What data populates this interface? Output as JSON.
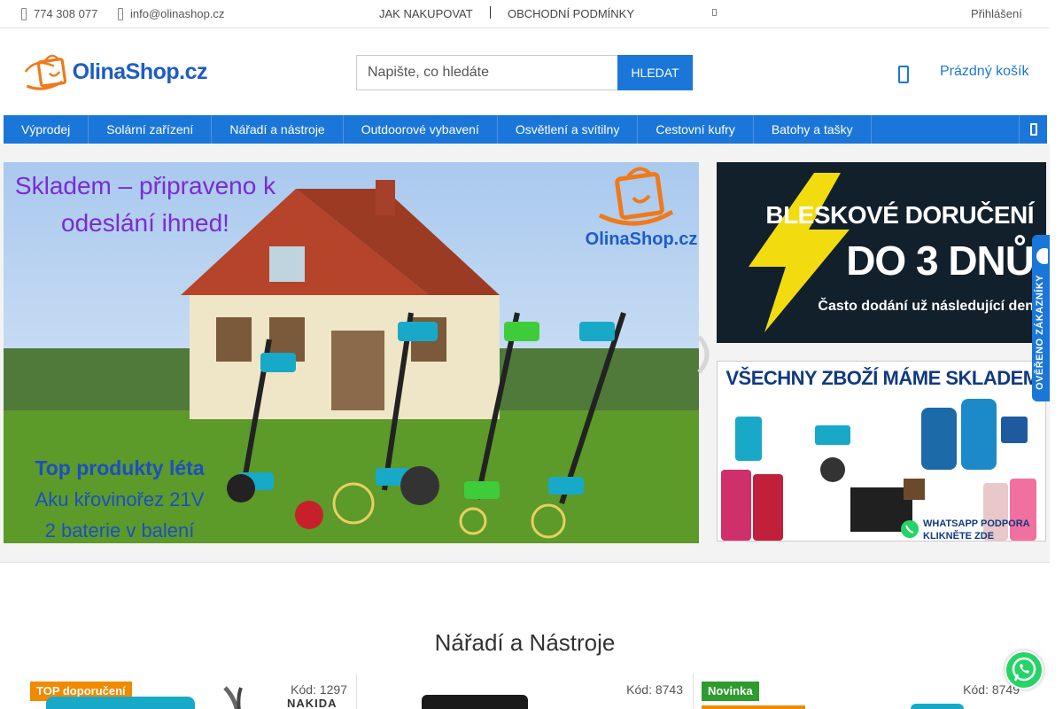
{
  "topbar": {
    "phone": "774 308 077",
    "email": "info@olinashop.cz",
    "links": [
      "JAK NAKUPOVAT",
      "OBCHODNÍ PODMÍNKY"
    ],
    "login": "Přihlášení"
  },
  "header": {
    "logo_text": "OlinaShop.cz",
    "search_placeholder": "Napište, co hledáte",
    "search_button": "HLEDAT",
    "cart_label": "Prázdný košík"
  },
  "nav": {
    "items": [
      "Výprodej",
      "Solární zařízení",
      "Nářadí a nástroje",
      "Outdoorové vybavení",
      "Osvětlení a svítilny",
      "Cestovní kufry",
      "Batohy a tašky"
    ]
  },
  "hero": {
    "headline_line1": "Skladem – připraveno k",
    "headline_line2": "odeslání ihned!",
    "logo_text": "OlinaShop.cz",
    "bottom_line1": "Top produkty léta",
    "bottom_line2": "Aku křovinořez 21V",
    "bottom_line3": "2 baterie v balení"
  },
  "side_banner_1": {
    "line1": "BLESKOVÉ DORUČENÍ",
    "line2": "DO 3 DNŮ",
    "line3": "Často dodání už následující den"
  },
  "side_banner_2": {
    "title": "VŠECHNY ZBOŽÍ MÁME SKLADEM",
    "whatsapp_line1": "WHATSAPP PODPORA",
    "whatsapp_line2": "KLIKNĚTE ZDE"
  },
  "verified_tab": "OVĚŘENO ZÁKAZNÍKY",
  "section": {
    "title": "Nářadí a Nástroje"
  },
  "products": [
    {
      "badge": "TOP doporučení",
      "code": "Kód: 1297",
      "brand": "NAKIDA"
    },
    {
      "badge": "",
      "code": "Kód: 8743"
    },
    {
      "badge": "Novinka",
      "code": "Kód: 8749"
    }
  ],
  "colors": {
    "brand_blue": "#1b76d9",
    "badge_orange": "#f08a00",
    "badge_green": "#2e9b2e",
    "whatsapp_green": "#25d366"
  }
}
